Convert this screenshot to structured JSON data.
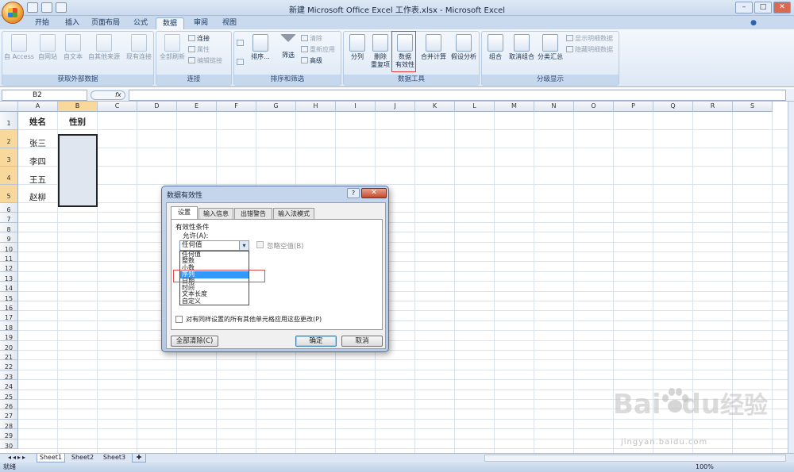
{
  "window": {
    "title": "新建 Microsoft Office Excel 工作表.xlsx - Microsoft Excel",
    "min": "–",
    "max": "□",
    "close": "✕"
  },
  "tabs": [
    {
      "label": "开始"
    },
    {
      "label": "插入"
    },
    {
      "label": "页面布局"
    },
    {
      "label": "公式"
    },
    {
      "label": "数据"
    },
    {
      "label": "审阅"
    },
    {
      "label": "视图"
    }
  ],
  "ribbon": {
    "get_external": {
      "label": "获取外部数据",
      "buttons": [
        "自 Access",
        "自网站",
        "自文本",
        "自其他来源",
        "现有连接"
      ]
    },
    "connections": {
      "label": "连接",
      "refresh": "全部刷新",
      "items": [
        "连接",
        "属性",
        "编辑链接"
      ]
    },
    "sort_filter": {
      "label": "排序和筛选",
      "sort": "排序...",
      "filter": "筛选",
      "az": "A↓Z",
      "items": [
        "清除",
        "重新应用",
        "高级"
      ]
    },
    "data_tools": {
      "label": "数据工具",
      "text_to_col": "分列",
      "remove_dup": "删除\n重复项",
      "validation": "数据\n有效性",
      "consolidate": "合并计算",
      "whatif": "假设分析"
    },
    "outline": {
      "label": "分级显示",
      "group": "组合",
      "ungroup": "取消组合",
      "subtotal": "分类汇总",
      "items": [
        "显示明细数据",
        "隐藏明细数据"
      ]
    }
  },
  "formula_bar": {
    "name_box": "B2",
    "fx": "fx",
    "content": ""
  },
  "columns": [
    "A",
    "B",
    "C",
    "D",
    "E",
    "F",
    "G",
    "H",
    "I",
    "J",
    "K",
    "L",
    "M",
    "N",
    "O",
    "P",
    "Q",
    "R",
    "S"
  ],
  "rows": [
    "1",
    "2",
    "3",
    "4",
    "5",
    "6",
    "7",
    "8",
    "9",
    "10",
    "11",
    "12",
    "13",
    "14",
    "15",
    "16",
    "17",
    "18",
    "19",
    "20",
    "21",
    "22",
    "23",
    "24",
    "25",
    "26",
    "27",
    "28",
    "29",
    "30"
  ],
  "cells": {
    "a1": "姓名",
    "b1": "性别",
    "a2": "张三",
    "a3": "李四",
    "a4": "王五",
    "a5": "赵柳"
  },
  "sheets": [
    "Sheet1",
    "Sheet2",
    "Sheet3"
  ],
  "status": {
    "text": "就绪",
    "zoom": "100%"
  },
  "dialog": {
    "title": "数据有效性",
    "help": "?",
    "close": "✕",
    "tabs": [
      "设置",
      "输入信息",
      "出错警告",
      "输入法模式"
    ],
    "section": "有效性条件",
    "allow_label": "允许(A):",
    "allow_value": "任何值",
    "ignore_blank": "忽略空值(B)",
    "options": [
      "任何值",
      "整数",
      "小数",
      "序列",
      "日期",
      "时间",
      "文本长度",
      "自定义"
    ],
    "selected_index": 3,
    "apply_all": "对有同样设置的所有其他单元格应用这些更改(P)",
    "clear_all": "全部清除(C)",
    "ok": "确定",
    "cancel": "取消"
  },
  "watermark": {
    "brand": "Bai",
    "brand2": "du",
    "cn": "经验",
    "url": "jingyan.baidu.com"
  }
}
